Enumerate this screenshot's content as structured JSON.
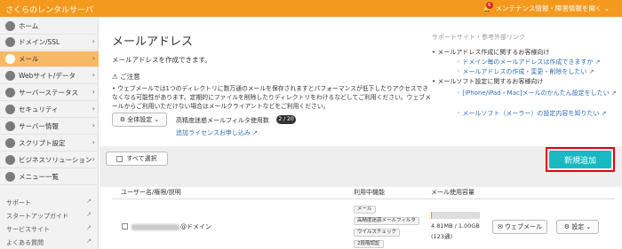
{
  "header": {
    "brand": "さくらのレンタルサーバ",
    "notice_count": "6",
    "notice_label": "メンテナンス情報・障害情報を開く ⌄"
  },
  "sidebar": {
    "items": [
      {
        "label": "ホーム",
        "icon": "home-icon",
        "active": false
      },
      {
        "label": "ドメイン/SSL",
        "icon": "globe-icon",
        "active": false
      },
      {
        "label": "メール",
        "icon": "mail-icon",
        "active": true
      },
      {
        "label": "Webサイト/データ",
        "icon": "web-icon",
        "active": false
      },
      {
        "label": "サーバーステータス",
        "icon": "server-icon",
        "active": false
      },
      {
        "label": "セキュリティ",
        "icon": "lock-icon",
        "active": false
      },
      {
        "label": "サーバー情報",
        "icon": "info-icon",
        "active": false
      },
      {
        "label": "スクリプト設定",
        "icon": "script-icon",
        "active": false
      },
      {
        "label": "ビジネスソリューション",
        "icon": "business-icon",
        "active": false
      },
      {
        "label": "メニュー一覧",
        "icon": "menu-icon",
        "active": false
      }
    ],
    "support_links": [
      "サポート",
      "スタートアップガイド",
      "サービスサイト",
      "よくある質問"
    ]
  },
  "main": {
    "title": "メールアドレス",
    "intro": "メールアドレスを作成できます。",
    "caution_head": "ご注意",
    "caution_text": "ウェブメールでは1つのディレクトリに数万通のメールを保存されますとパフォーマンスが低下したりアクセスできなくなる可能性があります。定期的にファイルを削除したりディレクトリをわけるなどしてご利用ください。ウェブメールからご利用いただけない場合はメールクライアントなどをご利用ください。",
    "settings_button": "全体設定",
    "filter_label": "高精度迷惑メールフィルタ使用数",
    "filter_count": "2 / 20",
    "add_license_link": "追加ライセンスお申し込み",
    "support": {
      "title": "サポートサイト・参考外部リンク",
      "groups": [
        {
          "heading": "メールアドレス作成に関するお客様向け",
          "links": [
            "ドメイン毎のメールアドレスは作成できますか",
            "メールアドレスの作成・変更・削除をしたい"
          ]
        },
        {
          "heading": "メールソフト設定に関するお客様向け",
          "links": [
            "[iPhone/iPad・Mac]メールのかんたん設定をしたい",
            "メールソフト（メーラー）の設定内容を知りたい"
          ]
        }
      ]
    },
    "select_all": "すべて選択",
    "new_button": "新規追加",
    "table": {
      "headers": [
        "ユーザー名/権限/説明",
        "利用中機能",
        "メール使用容量"
      ],
      "rows": [
        {
          "user_suffix": "@ドメイン",
          "features": [
            "メール",
            "高精度迷惑メールフィルタ",
            "ウイルスチェック",
            "2段階認証"
          ],
          "usage_fraction": 0.004,
          "usage_text": "4.81MB / 1.00GB",
          "usage_count": "(123通)",
          "webmail_button": "ウェブメール",
          "settings_button": "設定"
        }
      ]
    }
  }
}
